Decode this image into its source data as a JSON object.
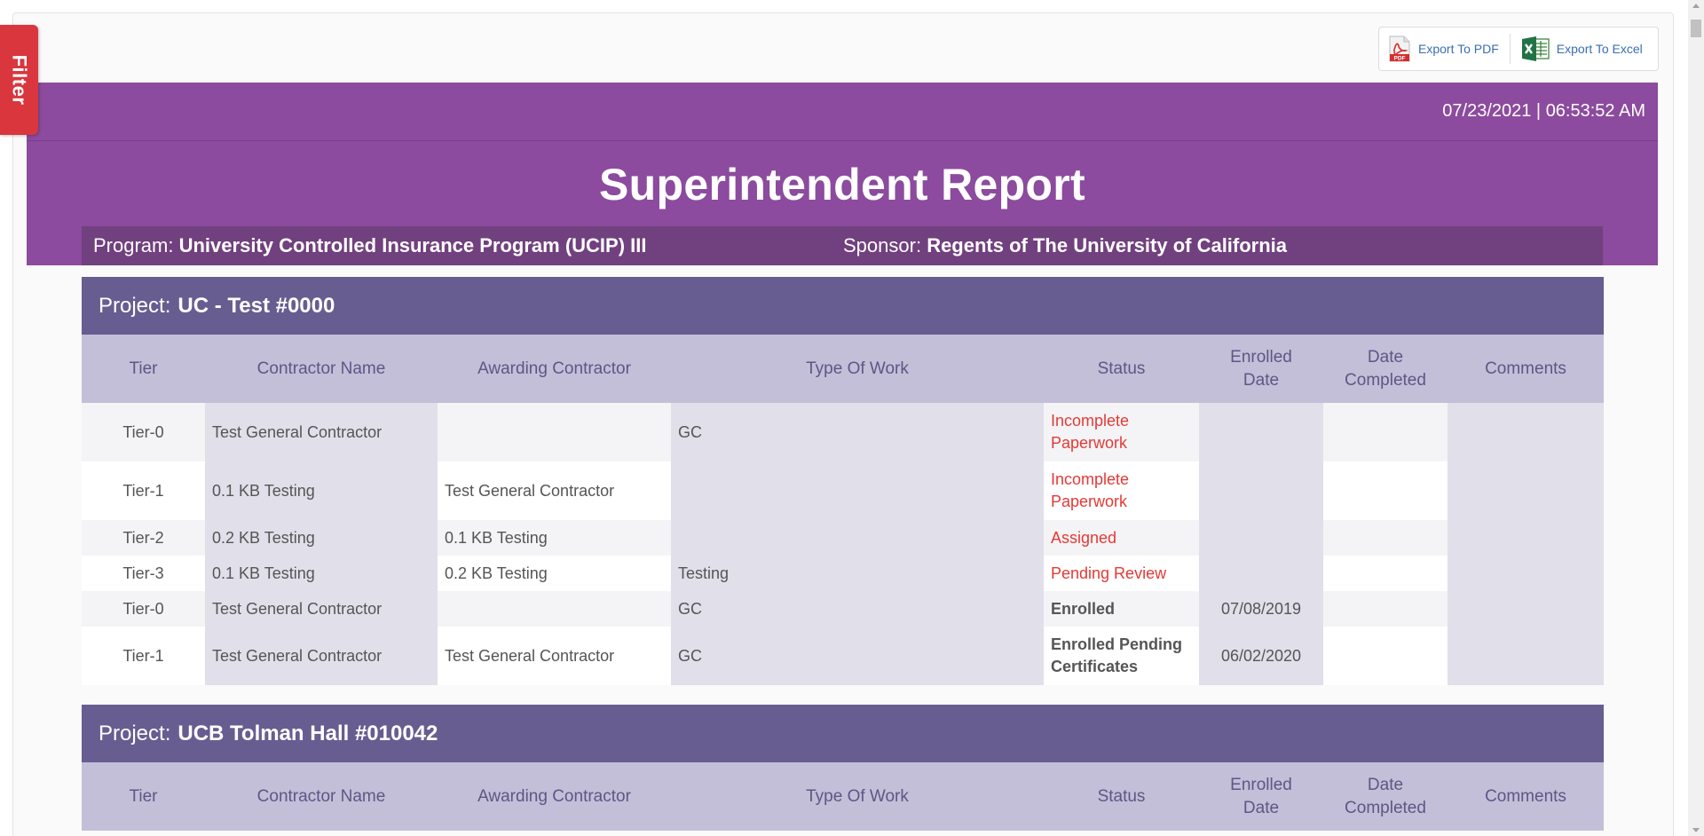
{
  "filter": {
    "label": "Filter"
  },
  "export": {
    "pdf_label": "Export To PDF",
    "excel_label": "Export To Excel",
    "pdf_icon_text": "PDF"
  },
  "header": {
    "datetime": "07/23/2021 | 06:53:52 AM",
    "title": "Superintendent Report",
    "program_label": "Program:",
    "program_value": "University Controlled Insurance Program (UCIP) III",
    "sponsor_label": "Sponsor:",
    "sponsor_value": "Regents of The University of California"
  },
  "columns": [
    "Tier",
    "Contractor Name",
    "Awarding Contractor",
    "Type Of Work",
    "Status",
    "Enrolled Date",
    "Date Completed",
    "Comments"
  ],
  "colors": {
    "purple": "#8c4b9e",
    "project_header": "#685d91",
    "table_header": "#c3bfd8",
    "status_red": "#e53935",
    "filter_red": "#d9363e"
  },
  "projects": [
    {
      "label": "Project:",
      "name": "UC - Test #0000",
      "rows": [
        {
          "tier": "Tier-0",
          "contractor": "Test General Contractor",
          "awarding": "",
          "work": "GC",
          "status": "Incomplete Paperwork",
          "status_style": "red",
          "enrolled": "",
          "completed": "",
          "comments": ""
        },
        {
          "tier": "Tier-1",
          "contractor": "0.1 KB Testing",
          "awarding": "Test General Contractor",
          "work": "",
          "status": "Incomplete Paperwork",
          "status_style": "red",
          "enrolled": "",
          "completed": "",
          "comments": ""
        },
        {
          "tier": "Tier-2",
          "contractor": "0.2 KB Testing",
          "awarding": "0.1 KB Testing",
          "work": "",
          "status": "Assigned",
          "status_style": "red",
          "enrolled": "",
          "completed": "",
          "comments": ""
        },
        {
          "tier": "Tier-3",
          "contractor": "0.1 KB Testing",
          "awarding": "0.2 KB Testing",
          "work": "Testing",
          "status": "Pending Review",
          "status_style": "red",
          "enrolled": "",
          "completed": "",
          "comments": ""
        },
        {
          "tier": "Tier-0",
          "contractor": "Test General Contractor",
          "awarding": "",
          "work": "GC",
          "status": "Enrolled",
          "status_style": "bold",
          "enrolled": "07/08/2019",
          "completed": "",
          "comments": ""
        },
        {
          "tier": "Tier-1",
          "contractor": "Test General Contractor",
          "awarding": "Test General Contractor",
          "work": "GC",
          "status": "Enrolled Pending Certificates",
          "status_style": "bold",
          "enrolled": "06/02/2020",
          "completed": "",
          "comments": ""
        }
      ]
    },
    {
      "label": "Project:",
      "name": "UCB Tolman Hall #010042",
      "rows": []
    }
  ]
}
